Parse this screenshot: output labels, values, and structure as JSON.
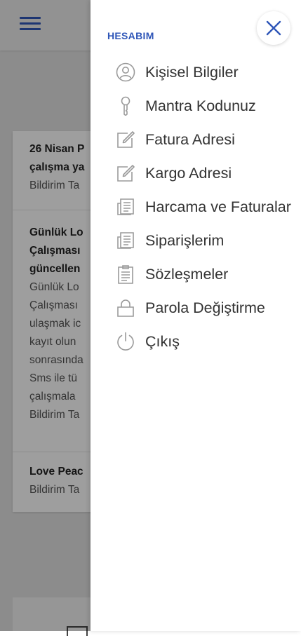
{
  "background": {
    "notifications": [
      {
        "title_lines": [
          "26 Nisan P",
          "çalışma ya"
        ],
        "meta": "Bildirim Ta"
      },
      {
        "title_lines": [
          "Günlük Lo",
          "Çalışması",
          "güncellen"
        ],
        "body_lines": [
          "Günlük Lo",
          "Çalışması",
          "ulaşmak ic",
          "kayıt olun",
          "sonrasında",
          "Sms ile tü",
          "çalışmala"
        ],
        "meta": "Bildirim Ta"
      },
      {
        "title_lines": [
          "Love Peac"
        ],
        "meta": "Bildirim Ta"
      }
    ]
  },
  "drawer": {
    "title": "HESABIM",
    "items": [
      {
        "label": "Kişisel Bilgiler",
        "icon": "user-icon"
      },
      {
        "label": "Mantra Kodunuz",
        "icon": "key-icon"
      },
      {
        "label": "Fatura Adresi",
        "icon": "edit-icon"
      },
      {
        "label": "Kargo Adresi",
        "icon": "edit-icon"
      },
      {
        "label": "Harcama ve Faturalar",
        "icon": "receipt-icon"
      },
      {
        "label": "Siparişlerim",
        "icon": "receipt-icon"
      },
      {
        "label": "Sözleşmeler",
        "icon": "clipboard-icon"
      },
      {
        "label": "Parola Değiştirme",
        "icon": "lock-icon"
      },
      {
        "label": "Çıkış",
        "icon": "power-icon"
      }
    ]
  },
  "colors": {
    "accent": "#2f56b8",
    "icon": "#9a9a9a",
    "text": "#333333"
  }
}
